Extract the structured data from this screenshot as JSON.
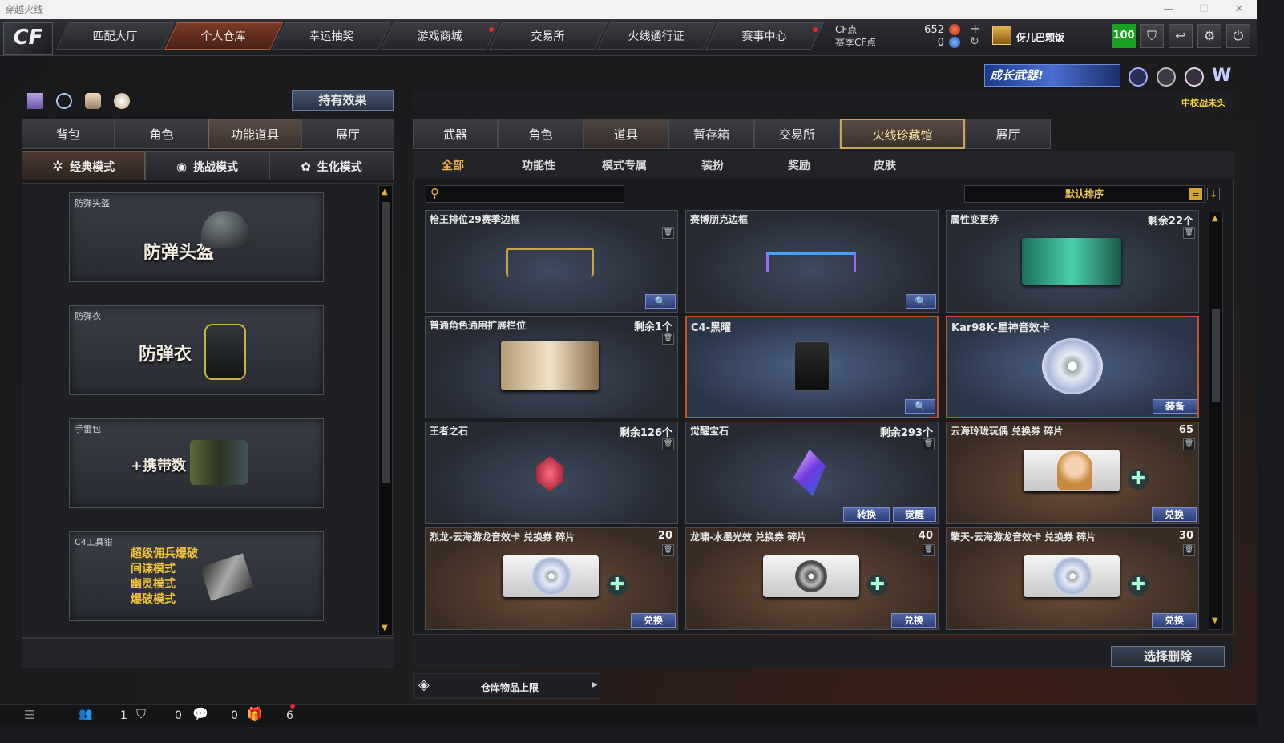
{
  "window": {
    "title": "穿越火线",
    "min": "—",
    "max": "☐",
    "close": "✕"
  },
  "nav": {
    "logo": "CF",
    "tabs": [
      "匹配大厅",
      "个人仓库",
      "幸运抽奖",
      "游戏商城",
      "交易所",
      "火线通行证",
      "赛事中心"
    ],
    "active": 1
  },
  "currency": {
    "cf_label": "CF点",
    "cf_value": "652",
    "season_label": "赛季CF点",
    "season_value": "0",
    "player": "伢儿巴颗饭",
    "level": "100"
  },
  "promo": {
    "banner": "成长武器!",
    "notice": "中校战未头"
  },
  "left": {
    "effects_button": "持有效果",
    "tabs": [
      "背包",
      "角色",
      "功能道具",
      "展厅"
    ],
    "active_tab": 2,
    "modes": [
      "经典模式",
      "挑战模式",
      "生化模式"
    ],
    "active_mode": 0,
    "items": [
      {
        "label": "防弹头盔",
        "big": "防弹头盔"
      },
      {
        "label": "防弹衣",
        "big": "防弹衣"
      },
      {
        "label": "手雷包",
        "big": "+携带数"
      },
      {
        "label": "C4工具钳",
        "lines": [
          "超级佣兵爆破",
          "间谍模式",
          "幽灵模式",
          "爆破模式"
        ]
      }
    ]
  },
  "right": {
    "tabs": [
      "武器",
      "角色",
      "道具",
      "暂存箱",
      "交易所",
      "火线珍藏馆",
      "展厅"
    ],
    "active_tab": 5,
    "filters": [
      "全部",
      "功能性",
      "模式专属",
      "装扮",
      "奖励",
      "皮肤"
    ],
    "active_filter": 0,
    "search_placeholder": "",
    "sort_label": "默认排序",
    "items": [
      {
        "name": "枪王排位29赛季边框",
        "count": "",
        "action": "🔍"
      },
      {
        "name": "赛博朋克边框",
        "count": "",
        "action": "🔍"
      },
      {
        "name": "属性变更券",
        "count": "剩余22个",
        "action": ""
      },
      {
        "name": "普通角色通用扩展栏位",
        "count": "剩余1个",
        "action": ""
      },
      {
        "name": "C4-黑曜",
        "count": "",
        "action": "🔍"
      },
      {
        "name": "Kar98K-星神音效卡",
        "count": "",
        "action": "装备"
      },
      {
        "name": "王者之石",
        "count": "剩余126个",
        "action": ""
      },
      {
        "name": "觉醒宝石",
        "count": "剩余293个",
        "action": "转换",
        "action2": "觉醒"
      },
      {
        "name": "云海玲珑玩偶 兑换券 碎片",
        "count": "65",
        "action": "兑换"
      },
      {
        "name": "烈龙-云海游龙音效卡 兑换券 碎片",
        "count": "20",
        "action": "兑换"
      },
      {
        "name": "龙啸-水墨光效 兑换券 碎片",
        "count": "40",
        "action": "兑换"
      },
      {
        "name": "擎天-云海游龙音效卡 兑换券 碎片",
        "count": "30",
        "action": "兑换"
      }
    ],
    "select_delete": "选择删除",
    "capacity": "仓库物品上限"
  },
  "status": {
    "v1": "1",
    "v2": "0",
    "v3": "0",
    "v4": "6"
  }
}
